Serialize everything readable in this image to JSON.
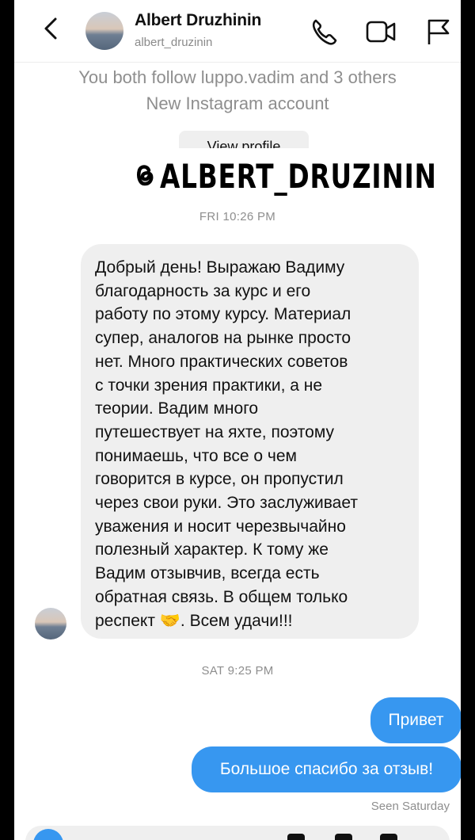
{
  "header": {
    "name": "Albert Druzhinin",
    "handle": "albert_druzinin"
  },
  "info": {
    "mutual": "You both follow luppo.vadim and 3 others",
    "new_account": "New Instagram account",
    "view_profile": "View profile"
  },
  "watermark": {
    "text": "ALBERT_DRUZININ"
  },
  "timestamps": {
    "first": "FRI 10:26 PM",
    "second": "SAT 9:25 PM"
  },
  "messages": {
    "incoming_lines": [
      "Добрый день! Выражаю Вадиму",
      "благодарность за курс и его",
      "работу по этому курсу. Материал",
      "супер, аналогов на рынке просто",
      "нет. Много практических советов",
      "с точки зрения практики, а не",
      "теории. Вадим много",
      "путешествует на яхте, поэтому",
      "понимаешь, что все о чем",
      "говорится в курсе, он пропустил",
      "через свои руки. Это заслуживает",
      "уважения и носит черезвычайно",
      "полезный характер. К тому же",
      "Вадим отзывчив, всегда есть",
      "обратная связь. В общем только",
      "респект 🤝. Всем удачи!!!"
    ],
    "outgoing_1": "Привет",
    "outgoing_2": "Большое спасибо за отзыв!",
    "seen": "Seen Saturday"
  },
  "icons": [
    "back-icon",
    "phone-icon",
    "video-icon",
    "flag-icon",
    "threads-icon",
    "camera-icon"
  ],
  "colors": {
    "accent": "#3797f0",
    "bubble_gray": "#efefef",
    "muted": "#8e8e8e"
  }
}
